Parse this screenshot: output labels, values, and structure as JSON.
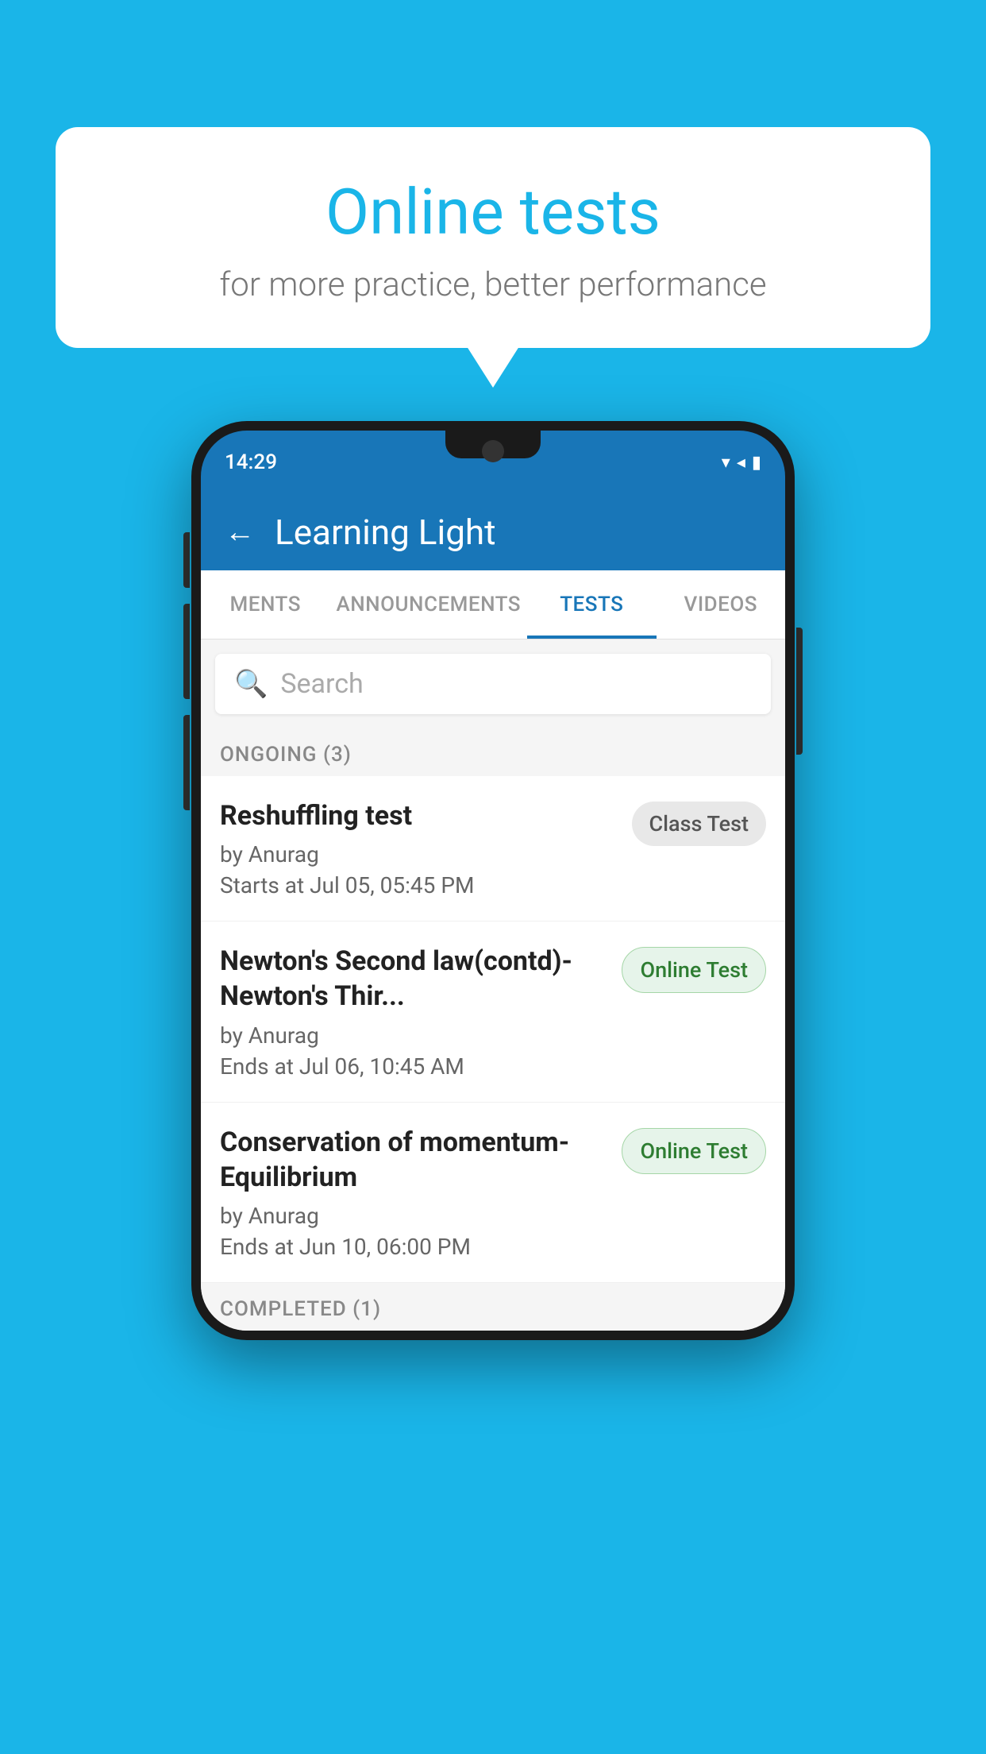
{
  "background": {
    "color": "#1ab5e8"
  },
  "speech_bubble": {
    "title": "Online tests",
    "subtitle": "for more practice, better performance"
  },
  "phone": {
    "status_bar": {
      "time": "14:29",
      "icons": "▾◂▮"
    },
    "app_header": {
      "back_label": "←",
      "title": "Learning Light"
    },
    "tabs": [
      {
        "label": "MENTS",
        "active": false
      },
      {
        "label": "ANNOUNCEMENTS",
        "active": false
      },
      {
        "label": "TESTS",
        "active": true
      },
      {
        "label": "VIDEOS",
        "active": false
      }
    ],
    "search": {
      "placeholder": "Search"
    },
    "ongoing_section": {
      "header": "ONGOING (3)",
      "items": [
        {
          "name": "Reshuffling test",
          "by": "by Anurag",
          "time": "Starts at  Jul 05, 05:45 PM",
          "badge": "Class Test",
          "badge_type": "class"
        },
        {
          "name": "Newton's Second law(contd)-Newton's Thir...",
          "by": "by Anurag",
          "time": "Ends at  Jul 06, 10:45 AM",
          "badge": "Online Test",
          "badge_type": "online"
        },
        {
          "name": "Conservation of momentum-Equilibrium",
          "by": "by Anurag",
          "time": "Ends at  Jun 10, 06:00 PM",
          "badge": "Online Test",
          "badge_type": "online"
        }
      ]
    },
    "completed_section": {
      "header": "COMPLETED (1)"
    }
  }
}
